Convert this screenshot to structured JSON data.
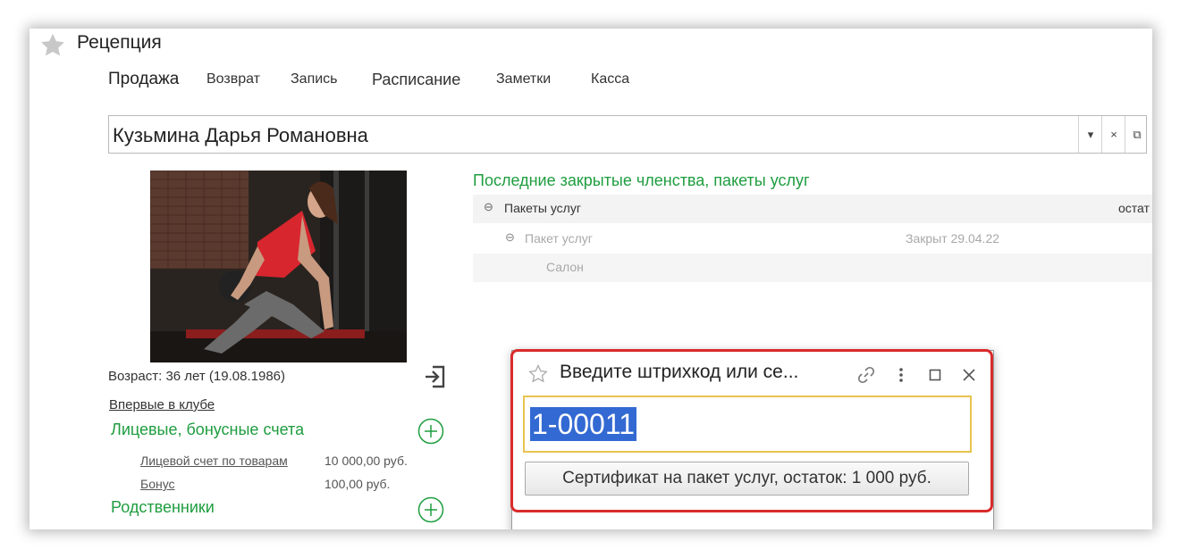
{
  "app": {
    "title": "Рецепция"
  },
  "tabs": [
    {
      "label": "Продажа"
    },
    {
      "label": "Возврат"
    },
    {
      "label": "Запись"
    },
    {
      "label": "Расписание"
    },
    {
      "label": "Заметки"
    },
    {
      "label": "Касса"
    }
  ],
  "client": {
    "name": "Кузьмина Дарья Романовна",
    "dropdown_icon": "▾",
    "clear_icon": "×",
    "open_icon": "⧉"
  },
  "profile": {
    "age": "Возраст: 36 лет (19.08.1986)",
    "first_visit": "Впервые в клубе"
  },
  "accounts": {
    "title": "Лицевые, бонусные счета",
    "rows": [
      {
        "label": "Лицевой счет по товарам",
        "value": "10 000,00 руб."
      },
      {
        "label": "Бонус",
        "value": "100,00 руб."
      }
    ]
  },
  "relatives": {
    "title": "Родственники"
  },
  "memberships": {
    "title": "Последние закрытые членства, пакеты услуг",
    "tree": [
      {
        "icon": "⊖",
        "label": "Пакеты услуг",
        "extra": "остат"
      },
      {
        "icon": "⊖",
        "label": "Пакет услуг",
        "extra": "Закрыт 29.04.22"
      },
      {
        "label": "Салон"
      }
    ]
  },
  "popup": {
    "title": "Введите штрихкод или се...",
    "input_value": "1-00011",
    "button_label": "Сертификат на пакет услуг, остаток: 1 000  руб."
  },
  "colors": {
    "green": "#1e9d3f",
    "highlight": "#e8c34e",
    "selection": "#3369d2",
    "annotation": "#d92b2b"
  }
}
